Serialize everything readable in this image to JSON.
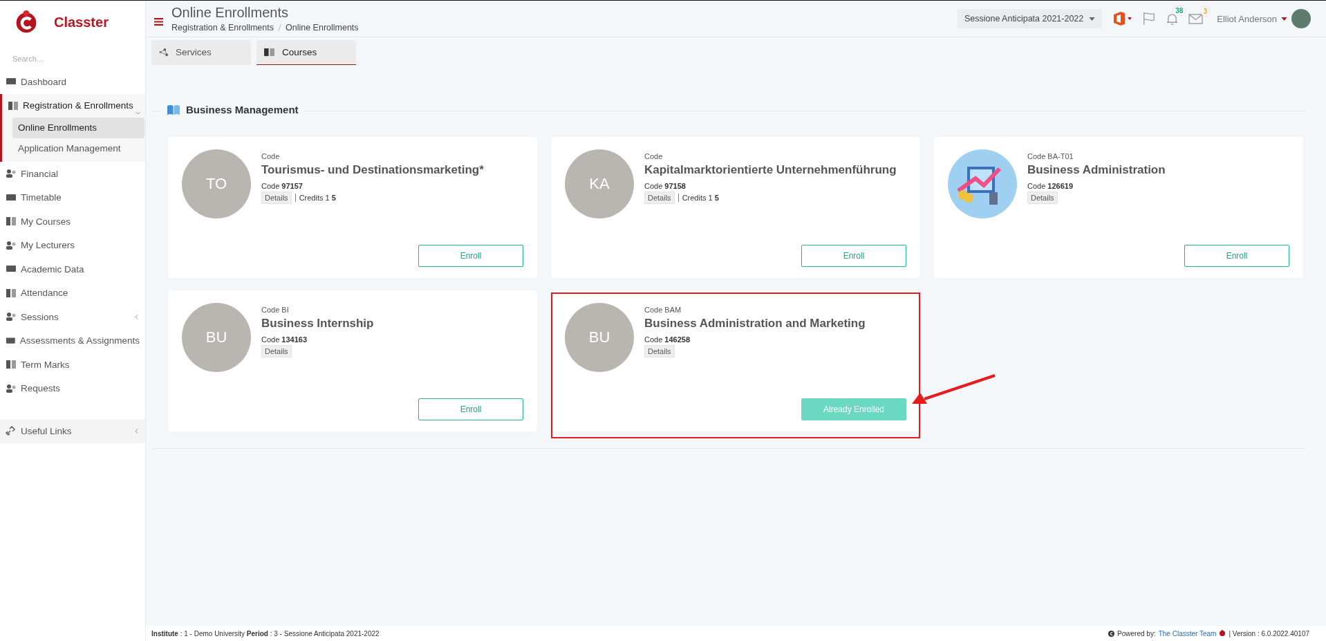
{
  "brand": {
    "name": "Classter"
  },
  "sidebar": {
    "search": {
      "placeholder": "Search..."
    },
    "items": [
      {
        "label": "Dashboard",
        "expanded": false,
        "submenu": false
      },
      {
        "label": "Registration & Enrollments",
        "expanded": true,
        "submenu": true,
        "children": [
          {
            "label": "Online Enrollments",
            "selected": true
          },
          {
            "label": "Application Management",
            "selected": false
          }
        ]
      },
      {
        "label": "Financial",
        "expanded": false,
        "submenu": false
      },
      {
        "label": "Timetable",
        "expanded": false,
        "submenu": false
      },
      {
        "label": "My Courses",
        "expanded": false,
        "submenu": false
      },
      {
        "label": "My Lecturers",
        "expanded": false,
        "submenu": false
      },
      {
        "label": "Academic Data",
        "expanded": false,
        "submenu": false
      },
      {
        "label": "Attendance",
        "expanded": false,
        "submenu": false
      },
      {
        "label": "Sessions",
        "expanded": false,
        "submenu": true
      },
      {
        "label": "Assessments & Assignments",
        "expanded": false,
        "submenu": false
      },
      {
        "label": "Term Marks",
        "expanded": false,
        "submenu": false
      },
      {
        "label": "Requests",
        "expanded": false,
        "submenu": false
      }
    ],
    "footer_item": {
      "label": "Useful Links",
      "submenu": true
    }
  },
  "header": {
    "title": "Online Enrollments",
    "breadcrumb": [
      "Registration & Enrollments",
      "Online Enrollments"
    ],
    "period": "Sessione Anticipata 2021-2022",
    "notifications": "38",
    "messages": "3",
    "user": "Elliot Anderson"
  },
  "tabs": [
    {
      "label": "Services",
      "selected": false
    },
    {
      "label": "Courses",
      "selected": true
    }
  ],
  "section": {
    "title": "Business Management",
    "courses": [
      {
        "code_label": "Code",
        "title": "Tourismus- und Destinationsmarketing*",
        "code": "Code **97157**",
        "details": "Details",
        "credits": "Credits 1 **5**",
        "avatar": {
          "kind": "initials",
          "text": "TO"
        },
        "button": {
          "kind": "enroll",
          "label": "Enroll"
        },
        "highlighted": false
      },
      {
        "code_label": "Code",
        "title": "Kapitalmarktorientierte Unternehmenführung",
        "code": "Code **97158**",
        "details": "Details",
        "credits": "Credits 1 **5**",
        "avatar": {
          "kind": "initials",
          "text": "KA"
        },
        "button": {
          "kind": "enroll",
          "label": "Enroll"
        },
        "highlighted": false
      },
      {
        "code_label": "Code BA-T01",
        "title": "Business Administration",
        "code": "Code **126619**",
        "details": "Details",
        "avatar": {
          "kind": "image"
        },
        "button": {
          "kind": "enroll",
          "label": "Enroll"
        },
        "highlighted": false
      },
      {
        "code_label": "Code BI",
        "title": "Business Internship",
        "code": "Code **134163**",
        "details": "Details",
        "avatar": {
          "kind": "initials",
          "text": "BU"
        },
        "button": {
          "kind": "enroll",
          "label": "Enroll"
        },
        "highlighted": false
      },
      {
        "code_label": "Code BAM",
        "title": "Business Administration and Marketing",
        "code": "Code **146258**",
        "details": "Details",
        "avatar": {
          "kind": "initials",
          "text": "BU"
        },
        "button": {
          "kind": "enrolled",
          "label": "Already Enrolled"
        },
        "highlighted": true
      }
    ]
  },
  "footer": {
    "info": "**Institute** : 1 - Demo University **Period** : 3 - Sessione Anticipata 2021-2022",
    "powered": "Powered by:",
    "team": "The Classter Team",
    "version": "| Version : 6.0.2022.40107"
  }
}
